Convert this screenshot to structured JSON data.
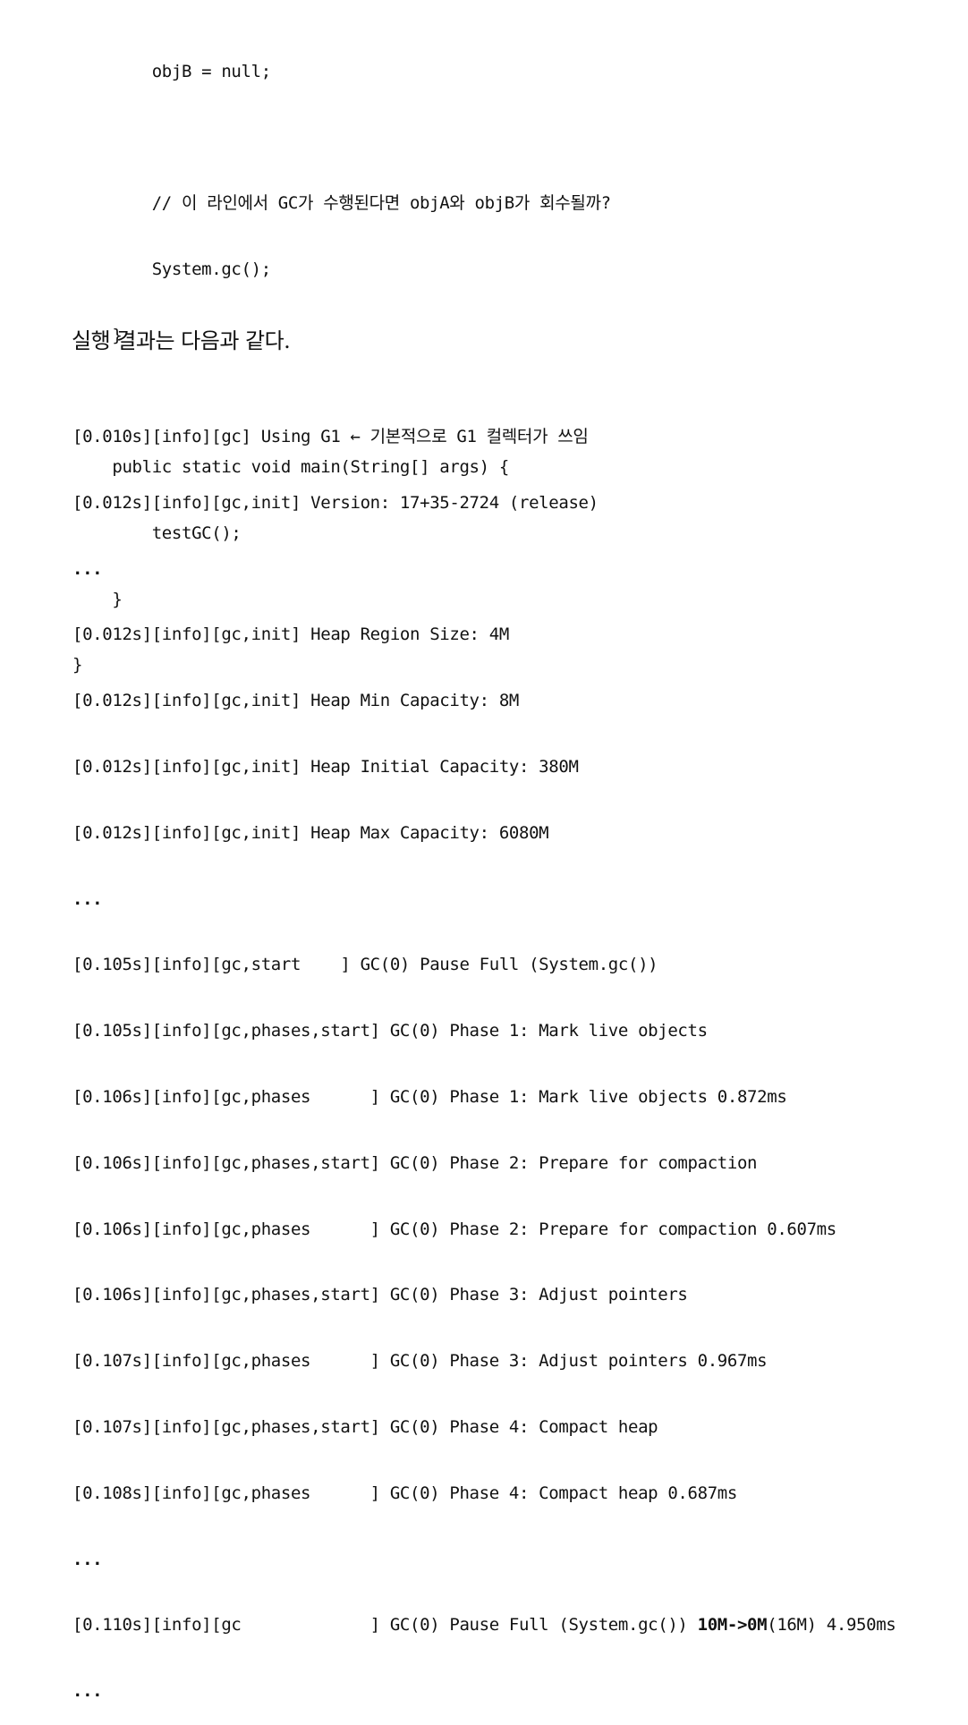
{
  "code_lines": [
    "        objB = null;",
    "",
    "        // 이 라인에서 GC가 수행된다면 objA와 objB가 회수될까?",
    "        System.gc();",
    "    }",
    "",
    "    public static void main(String[] args) {",
    "        testGC();",
    "    }",
    "}"
  ],
  "prose_text": "실행 결과는 다음과 같다.",
  "log_lines": [
    {
      "text": "[0.010s][info][gc] Using G1 ← 기본적으로 G1 컬렉터가 쓰임"
    },
    {
      "text": "[0.012s][info][gc,init] Version: 17+35-2724 (release)"
    },
    {
      "text": "...",
      "bold_all": true
    },
    {
      "text": "[0.012s][info][gc,init] Heap Region Size: 4M"
    },
    {
      "text": "[0.012s][info][gc,init] Heap Min Capacity: 8M"
    },
    {
      "text": "[0.012s][info][gc,init] Heap Initial Capacity: 380M"
    },
    {
      "text": "[0.012s][info][gc,init] Heap Max Capacity: 6080M"
    },
    {
      "text": "...",
      "bold_all": true
    },
    {
      "text": "[0.105s][info][gc,start    ] GC(0) Pause Full (System.gc())"
    },
    {
      "text": "[0.105s][info][gc,phases,start] GC(0) Phase 1: Mark live objects"
    },
    {
      "text": "[0.106s][info][gc,phases      ] GC(0) Phase 1: Mark live objects 0.872ms"
    },
    {
      "text": "[0.106s][info][gc,phases,start] GC(0) Phase 2: Prepare for compaction"
    },
    {
      "text": "[0.106s][info][gc,phases      ] GC(0) Phase 2: Prepare for compaction 0.607ms"
    },
    {
      "text": "[0.106s][info][gc,phases,start] GC(0) Phase 3: Adjust pointers"
    },
    {
      "text": "[0.107s][info][gc,phases      ] GC(0) Phase 3: Adjust pointers 0.967ms"
    },
    {
      "text": "[0.107s][info][gc,phases,start] GC(0) Phase 4: Compact heap"
    },
    {
      "text": "[0.108s][info][gc,phases      ] GC(0) Phase 4: Compact heap 0.687ms"
    },
    {
      "text": "...",
      "bold_all": true
    },
    {
      "text": "[0.110s][info][gc             ] GC(0) Pause Full (System.gc()) ",
      "highlight": "10M->0M",
      "suffix": "(16M) 4.950ms"
    },
    {
      "text": "...",
      "bold_all": true
    }
  ]
}
